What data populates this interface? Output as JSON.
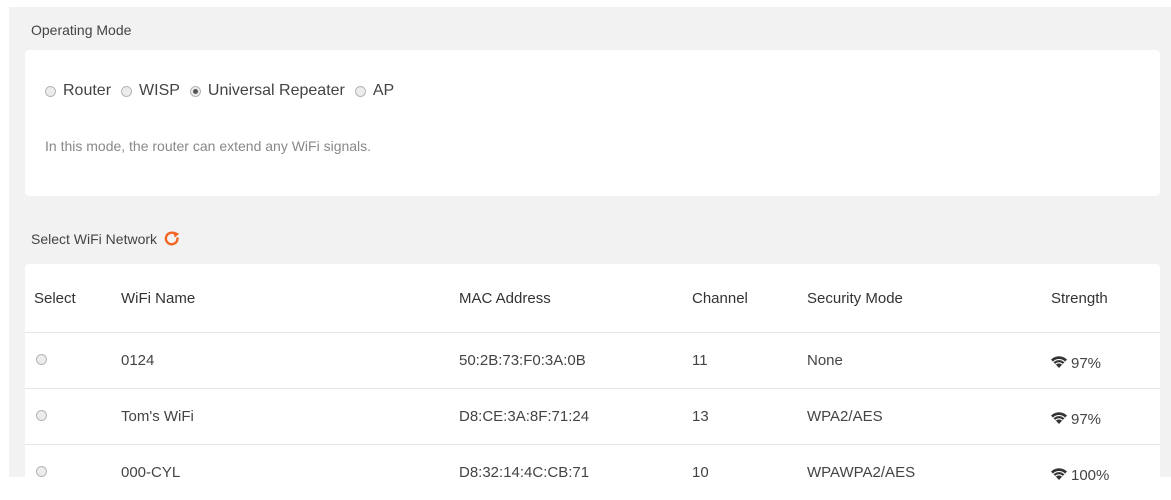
{
  "operating_mode": {
    "title": "Operating Mode",
    "options": [
      {
        "label": "Router",
        "checked": false
      },
      {
        "label": "WISP",
        "checked": false
      },
      {
        "label": "Universal Repeater",
        "checked": true
      },
      {
        "label": "AP",
        "checked": false
      }
    ],
    "description": "In this mode, the router can extend any WiFi signals."
  },
  "wifi_network": {
    "title": "Select WiFi Network",
    "refresh_icon": "refresh-icon",
    "accent_color": "#f26522",
    "columns": {
      "select": "Select",
      "name": "WiFi Name",
      "mac": "MAC Address",
      "channel": "Channel",
      "security": "Security Mode",
      "strength": "Strength"
    },
    "rows": [
      {
        "name": "0124",
        "mac": "50:2B:73:F0:3A:0B",
        "channel": "11",
        "security": "None",
        "strength": "97%"
      },
      {
        "name": "Tom's WiFi",
        "mac": "D8:CE:3A:8F:71:24",
        "channel": "13",
        "security": "WPA2/AES",
        "strength": "97%"
      },
      {
        "name": "000-CYL",
        "mac": "D8:32:14:4C:CB:71",
        "channel": "10",
        "security": "WPAWPA2/AES",
        "strength": "100%"
      }
    ]
  }
}
